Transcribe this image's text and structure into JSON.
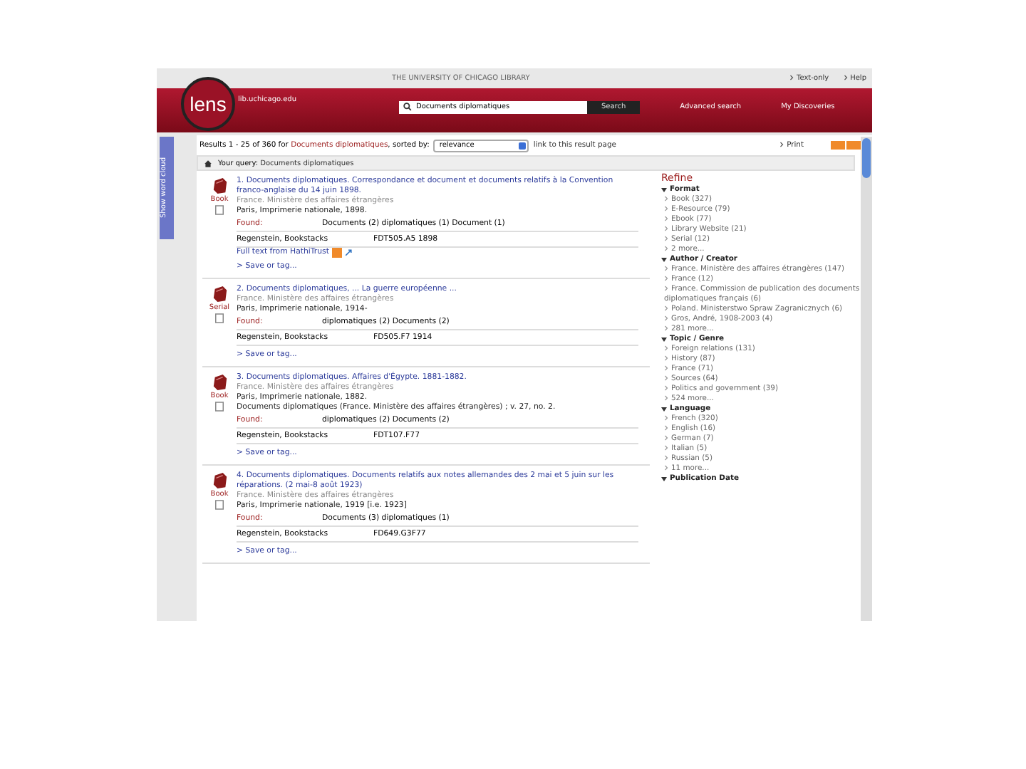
{
  "header": {
    "institution": "THE UNIVERSITY OF CHICAGO LIBRARY",
    "links": [
      "Text-only",
      "Help"
    ],
    "logo": "lens",
    "domain": "lib.uchicago.edu",
    "search": {
      "value": "Documents diplomatiques",
      "button": "Search"
    },
    "nav": [
      "Advanced search",
      "My Discoveries"
    ]
  },
  "side_tab": "Show word cloud",
  "results_bar": {
    "summary": "Results 1 - 25 of 360 for",
    "query": "Documents diplomatiques",
    "sorted_label": ", sorted by:",
    "sort": "relevance",
    "link": "link to this result page",
    "print": "Print"
  },
  "breadcrumb": {
    "label": "Your query:",
    "query": "Documents diplomatiques"
  },
  "results": [
    {
      "format": "Book",
      "title": "1. Documents diplomatiques.",
      "rest": "Correspondance et document et documents relatifs à la Convention franco-anglaise du 14 juin 1898.",
      "author": "France. Ministère des affaires étrangères",
      "imprint": "Paris, Imprimerie nationale, 1898.",
      "found_label": "Found:",
      "found": "Documents (2) diplomatiques (1) Document (1)",
      "location": "Regenstein, Bookstacks",
      "call": "FDT505.A5 1898",
      "fulltext": "Full text from HathiTrust",
      "save": "> Save or tag..."
    },
    {
      "format": "Serial",
      "title": "2. Documents diplomatiques,",
      "rest": "... La guerre européenne ...",
      "author": "France. Ministère des affaires étrangères",
      "imprint": "Paris, Imprimerie nationale, 1914-",
      "found_label": "Found:",
      "found": "diplomatiques (2) Documents (2)",
      "location": "Regenstein, Bookstacks",
      "call": "FD505.F7 1914",
      "save": "> Save or tag..."
    },
    {
      "format": "Book",
      "title": "3. Documents diplomatiques.",
      "rest": "Affaires d'Égypte. 1881-1882.",
      "author": "France. Ministère des affaires étrangères",
      "imprint": "Paris, Imprimerie nationale, 1882.",
      "series": "Documents diplomatiques (France. Ministère des affaires étrangères) ; v. 27, no. 2.",
      "found_label": "Found:",
      "found": "diplomatiques (2) Documents (2)",
      "location": "Regenstein, Bookstacks",
      "call": "FDT107.F77",
      "save": "> Save or tag..."
    },
    {
      "format": "Book",
      "title": "4. Documents diplomatiques.",
      "rest": "Documents relatifs aux notes allemandes des 2 mai et 5 juin sur les réparations. (2 mai-8 août 1923)",
      "author": "France. Ministère des affaires étrangères",
      "imprint": "Paris, Imprimerie nationale, 1919 [i.e. 1923]",
      "found_label": "Found:",
      "found": "Documents (3) diplomatiques (1)",
      "location": "Regenstein, Bookstacks",
      "call": "FD649.G3F77",
      "save": "> Save or tag..."
    }
  ],
  "refine": {
    "title": "Refine",
    "facets": [
      {
        "name": "Format",
        "expanded": true,
        "items": [
          "Book (327)",
          "E-Resource (79)",
          "Ebook (77)",
          "Library Website (21)",
          "Serial (12)",
          "2 more..."
        ]
      },
      {
        "name": "Author / Creator",
        "expanded": true,
        "items": [
          "France. Ministère des affaires étrangères (147)",
          "France (12)",
          "France. Commission de publication des documents diplomatiques français (6)",
          "Poland. Ministerstwo Spraw Zagranicznych (6)",
          "Gros, André, 1908-2003 (4)",
          "281 more..."
        ]
      },
      {
        "name": "Topic / Genre",
        "expanded": true,
        "items": [
          "Foreign relations (131)",
          "History (87)",
          "France (71)",
          "Sources (64)",
          "Politics and government (39)",
          "524 more..."
        ]
      },
      {
        "name": "Language",
        "expanded": true,
        "items": [
          "French (320)",
          "English (16)",
          "German (7)",
          "Italian (5)",
          "Russian (5)",
          "11 more..."
        ]
      },
      {
        "name": "Publication Date",
        "expanded": true
      }
    ]
  }
}
